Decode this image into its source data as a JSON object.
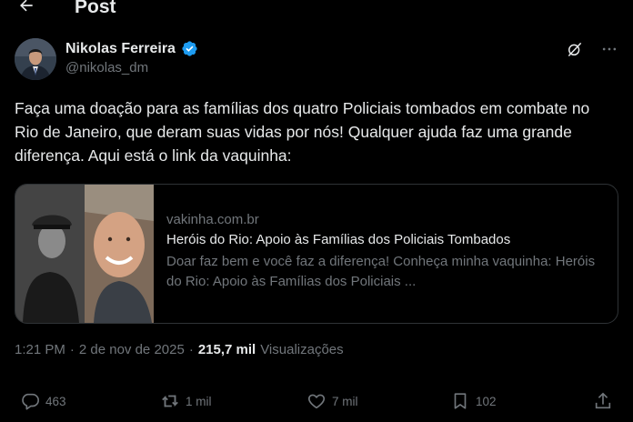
{
  "header": {
    "title": "Post"
  },
  "author": {
    "name": "Nikolas Ferreira",
    "handle": "@nikolas_dm"
  },
  "post": {
    "text": "Faça uma doação para as famílias dos quatro Policiais tombados em combate no Rio de Janeiro, que deram suas vidas por nós! Qualquer ajuda faz uma grande diferença. Aqui está o link da vaquinha:"
  },
  "card": {
    "domain": "vakinha.com.br",
    "title": "Heróis do Rio: Apoio às Famílias dos Policiais Tombados",
    "description": "Doar faz bem e você faz a diferença! Conheça minha vaquinha: Heróis do Rio: Apoio às Famílias dos Policiais ..."
  },
  "meta": {
    "time": "1:21 PM",
    "sep1": "·",
    "date": "2 de nov de 2025",
    "sep2": "·",
    "views_count": "215,7 mil",
    "views_label": "Visualizações"
  },
  "actions": {
    "replies": "463",
    "reposts": "1 mil",
    "likes": "7 mil",
    "bookmarks": "102"
  },
  "icons": [
    "back-arrow-icon",
    "verified-badge-icon",
    "grok-icon",
    "more-icon",
    "reply-icon",
    "repost-icon",
    "like-icon",
    "bookmark-icon",
    "share-icon"
  ],
  "colors": {
    "background": "#000000",
    "text": "#e7e9ea",
    "muted": "#71767b",
    "verified": "#1d9bf0",
    "border": "#2f3336"
  }
}
